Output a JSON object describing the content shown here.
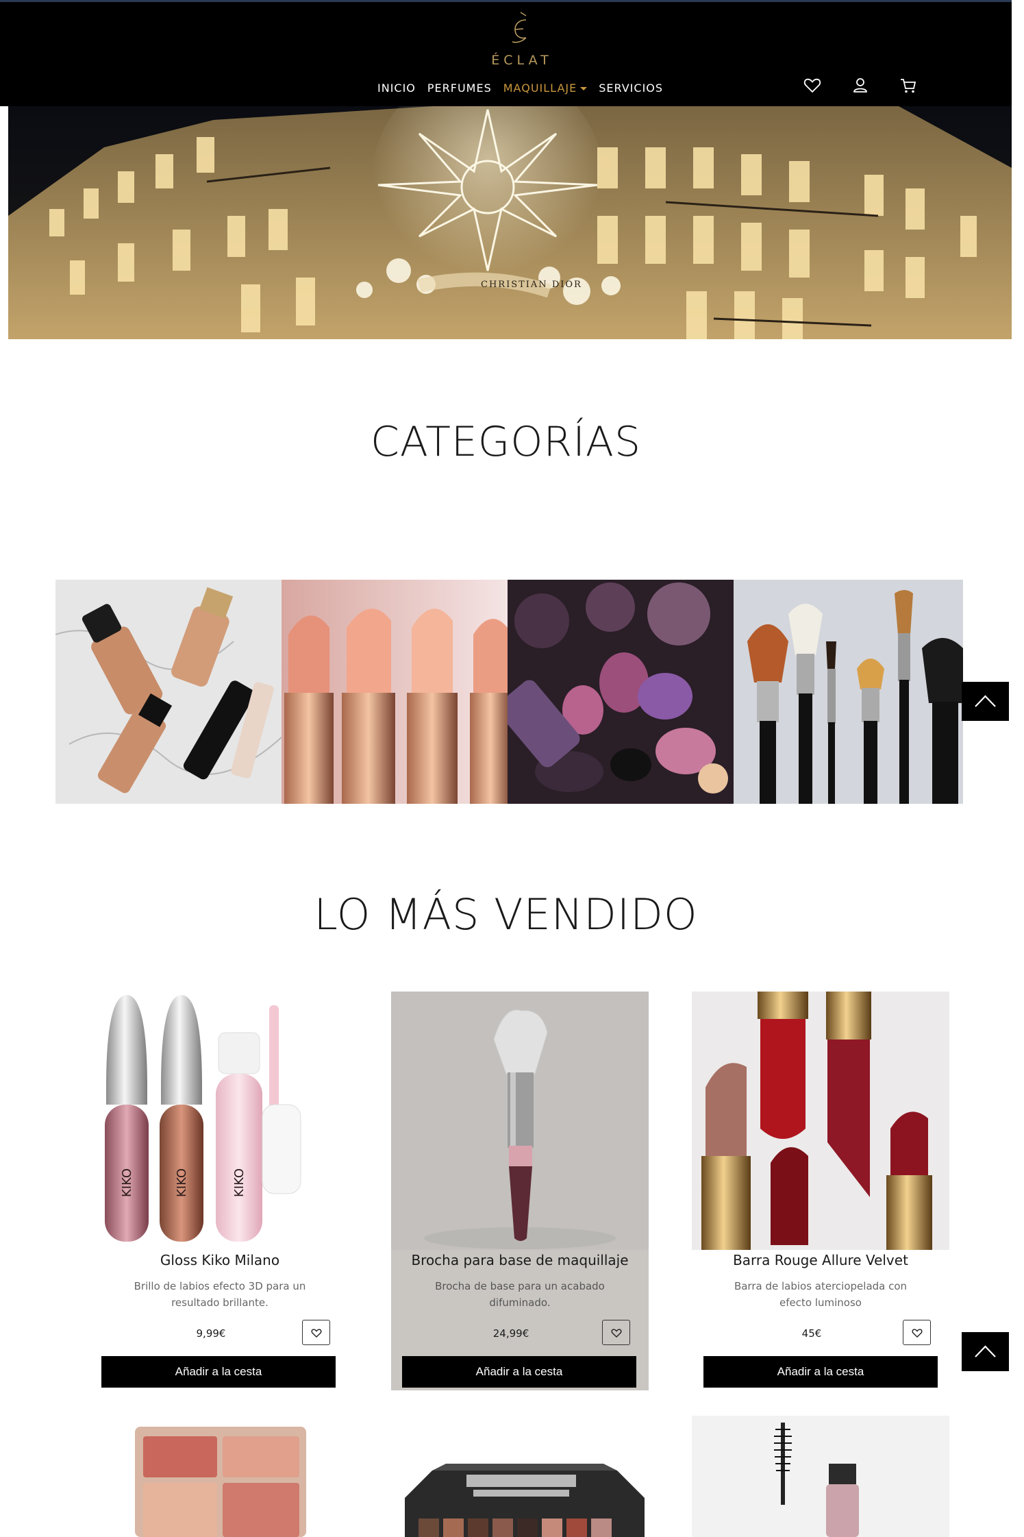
{
  "brand": {
    "name": "ÉCLAT",
    "accent_color": "#c9973f"
  },
  "nav": {
    "items": [
      {
        "label": "INICIO"
      },
      {
        "label": "PERFUMES"
      },
      {
        "label": "MAQUILLAJE",
        "active": true,
        "dropdown": true
      },
      {
        "label": "SERVICIOS"
      }
    ]
  },
  "header_icons": [
    "heart-icon",
    "user-icon",
    "cart-icon"
  ],
  "hero": {
    "sign_text": "CHRISTIAN DIOR"
  },
  "categories": {
    "title": "CATEGORÍAS",
    "tiles": [
      "foundation",
      "lipstick",
      "eyeshadow",
      "brushes"
    ]
  },
  "bestsellers": {
    "title": "LO MÁS VENDIDO",
    "products": [
      {
        "name": "Gloss Kiko Milano",
        "description": "Brillo de labios efecto 3D para un resultado brillante.",
        "price": "9,99€",
        "cta": "Añadir a la cesta"
      },
      {
        "name": "Brocha para base de maquillaje",
        "description": "Brocha de base para un acabado difuminado.",
        "price": "24,99€",
        "cta": "Añadir a la cesta"
      },
      {
        "name": "Barra Rouge Allure Velvet",
        "description": "Barra de labios aterciopelada con efecto luminoso",
        "price": "45€",
        "cta": "Añadir a la cesta"
      }
    ],
    "next_row": [
      "blush-palette",
      "pretty-grunge-palette",
      "mascara"
    ]
  },
  "colors": {
    "header_bg": "#000000",
    "button_bg": "#000000",
    "hover_card_bg": "#c9c6c2"
  }
}
